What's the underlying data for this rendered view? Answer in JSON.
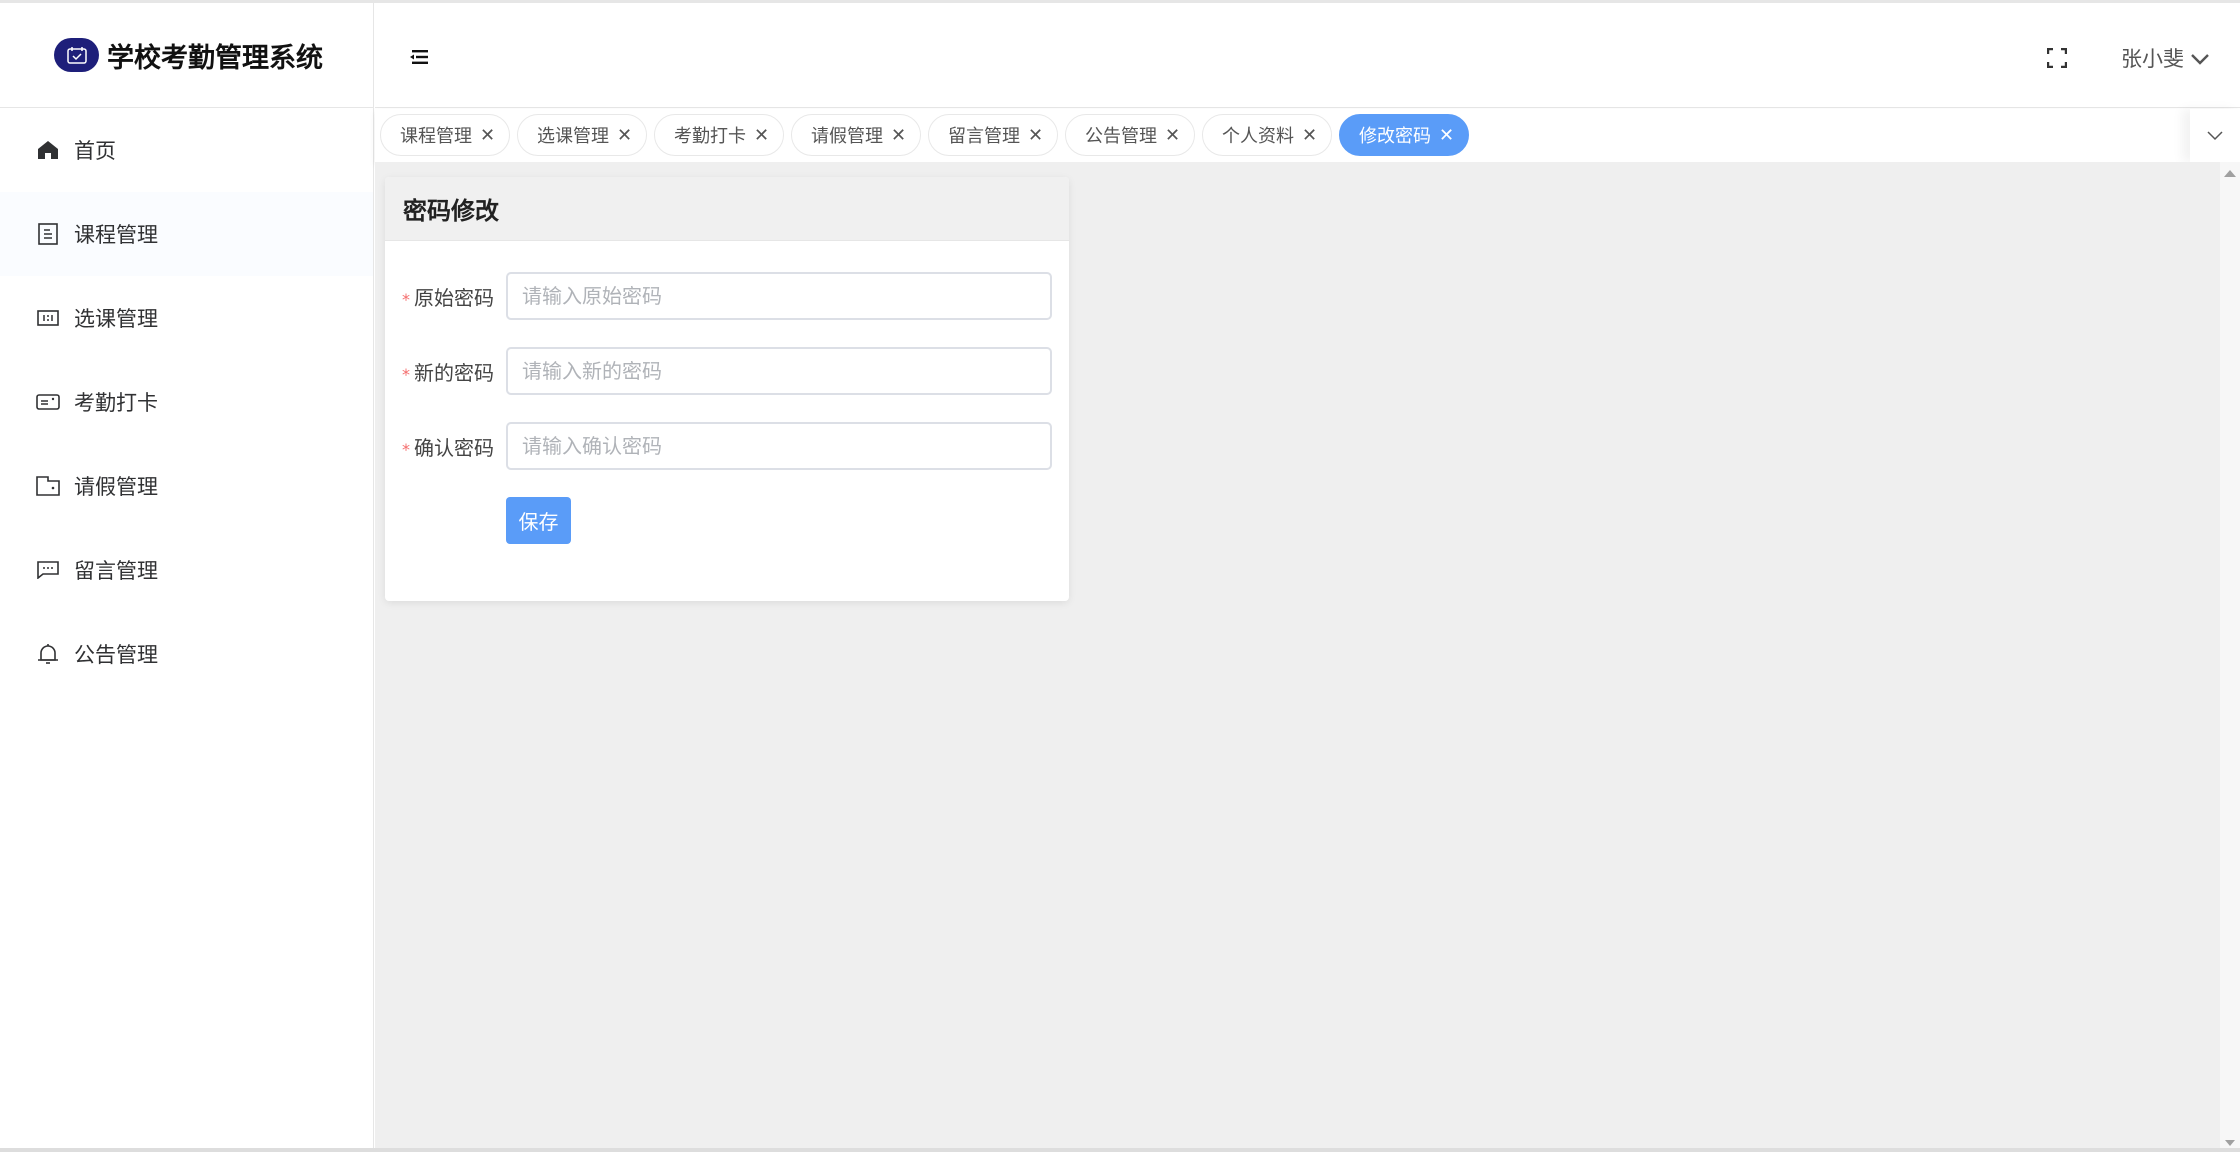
{
  "app": {
    "title": "学校考勤管理系统",
    "accent": "#5a9cf8"
  },
  "sidebar": {
    "items": [
      {
        "label": "首页",
        "icon": "home-icon"
      },
      {
        "label": "课程管理",
        "icon": "document-icon"
      },
      {
        "label": "选课管理",
        "icon": "select-icon"
      },
      {
        "label": "考勤打卡",
        "icon": "card-icon"
      },
      {
        "label": "请假管理",
        "icon": "wallet-icon"
      },
      {
        "label": "留言管理",
        "icon": "chat-icon"
      },
      {
        "label": "公告管理",
        "icon": "bell-icon"
      }
    ]
  },
  "header": {
    "user": "张小斐"
  },
  "tabs": [
    {
      "label": "课程管理"
    },
    {
      "label": "选课管理"
    },
    {
      "label": "考勤打卡"
    },
    {
      "label": "请假管理"
    },
    {
      "label": "留言管理"
    },
    {
      "label": "公告管理"
    },
    {
      "label": "个人资料"
    },
    {
      "label": "修改密码",
      "active": true
    }
  ],
  "form": {
    "title": "密码修改",
    "fields": [
      {
        "label": "原始密码",
        "placeholder": "请输入原始密码",
        "value": ""
      },
      {
        "label": "新的密码",
        "placeholder": "请输入新的密码",
        "value": ""
      },
      {
        "label": "确认密码",
        "placeholder": "请输入确认密码",
        "value": ""
      }
    ],
    "required_mark": "*",
    "save_label": "保存"
  }
}
